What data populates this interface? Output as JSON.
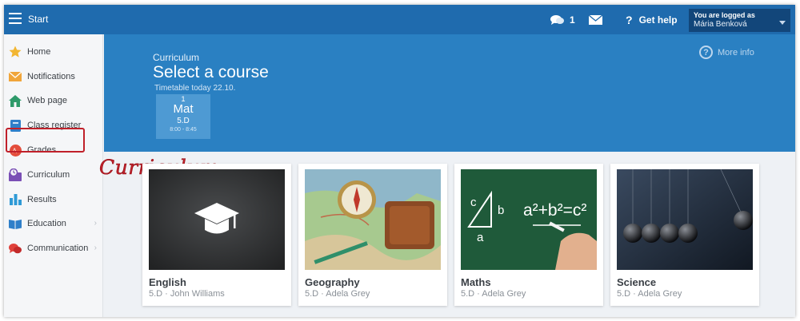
{
  "topbar": {
    "menu_icon": "hamburger-icon",
    "title": "Start",
    "chat_count": "1",
    "help_label": "Get help",
    "help_icon": "?",
    "user_status": "You are logged as",
    "user_name": "Mária Benková"
  },
  "sidebar": {
    "items": [
      {
        "label": "Home",
        "icon": "star-icon"
      },
      {
        "label": "Notifications",
        "icon": "envelope-icon"
      },
      {
        "label": "Web page",
        "icon": "house-icon"
      },
      {
        "label": "Class register",
        "icon": "book-icon"
      },
      {
        "label": "Grades",
        "icon": "grades-icon"
      },
      {
        "label": "Curriculum",
        "icon": "curriculum-icon"
      },
      {
        "label": "Results",
        "icon": "bar-chart-icon"
      },
      {
        "label": "Education",
        "icon": "open-book-icon",
        "has_submenu": true
      },
      {
        "label": "Communication",
        "icon": "speech-bubbles-icon",
        "has_submenu": true
      }
    ]
  },
  "annotation": "Curriculum",
  "hero": {
    "kicker": "Curriculum",
    "title": "Select a course",
    "timetable": "Timetable today 22.10.",
    "more_info": "More info",
    "more_info_icon": "?",
    "lesson": {
      "number": "1",
      "subject": "Mat",
      "class": "5.D",
      "time": "8:00 - 8:45"
    }
  },
  "courses": [
    {
      "name": "English",
      "meta": "5.D · John Williams",
      "image": "graduation-cap-chalkboard"
    },
    {
      "name": "Geography",
      "meta": "5.D · Adela Grey",
      "image": "compass-map"
    },
    {
      "name": "Maths",
      "meta": "5.D · Adela Grey",
      "image": "pythagoras-chalkboard"
    },
    {
      "name": "Science",
      "meta": "5.D · Adela Grey",
      "image": "newtons-cradle"
    }
  ],
  "colors": {
    "topbar": "#1f6bae",
    "hero": "#2a80c2",
    "highlight": "#c0202a"
  }
}
